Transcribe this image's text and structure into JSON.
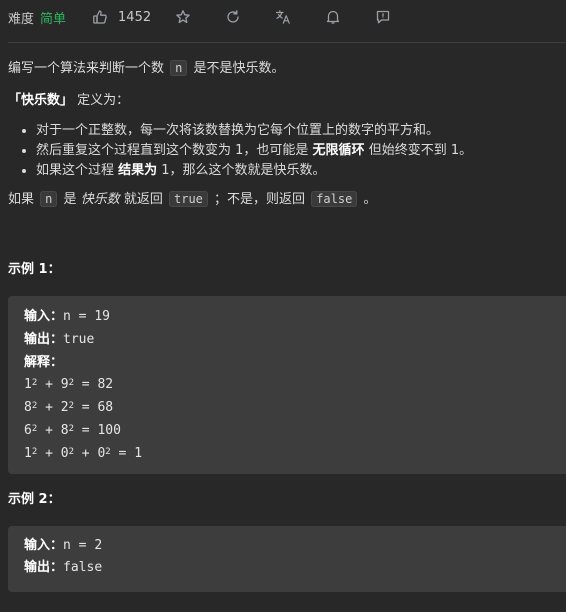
{
  "header": {
    "difficulty_label": "难度",
    "difficulty_value": "简单",
    "likes": "1452",
    "icons": [
      "thumbs-up-icon",
      "star-icon",
      "refresh-icon",
      "translate-icon",
      "bell-icon",
      "comment-icon"
    ],
    "difficulty_color": "#2db55d"
  },
  "problem": {
    "p1_pre": "编写一个算法来判断一个数",
    "p1_code": "n",
    "p1_post": "是不是快乐数。",
    "p2_term": "「快乐数」",
    "p2_post": "定义为：",
    "bullets": [
      {
        "text": "对于一个正整数，每一次将该数替换为它每个位置上的数字的平方和。"
      },
      {
        "pre": "然后重复这个过程直到这个数变为 1，也可能是 ",
        "bold": "无限循环",
        "post": " 但始终变不到 1。"
      },
      {
        "pre": "如果这个过程 ",
        "bold": "结果为",
        "post": " 1，那么这个数就是快乐数。"
      }
    ],
    "p3_a": "如果",
    "p3_code1": "n",
    "p3_b": "是",
    "p3_em": "快乐数",
    "p3_c": "就返回",
    "p3_code2": "true",
    "p3_d": "；不是，则返回",
    "p3_code3": "false",
    "p3_e": "。"
  },
  "examples": [
    {
      "title": "示例 1：",
      "input_label": "输入：",
      "input": "n = 19",
      "output_label": "输出：",
      "output": "true",
      "explain_label": "解释：",
      "lines": [
        {
          "a": "1",
          "b": "9",
          "r": "82"
        },
        {
          "a": "8",
          "b": "2",
          "r": "68"
        },
        {
          "a": "6",
          "b": "8",
          "r": "100"
        },
        {
          "a": "1",
          "b": "0",
          "c": "0",
          "r": "1"
        }
      ]
    },
    {
      "title": "示例 2：",
      "input_label": "输入：",
      "input": "n = 2",
      "output_label": "输出：",
      "output": "false"
    }
  ]
}
